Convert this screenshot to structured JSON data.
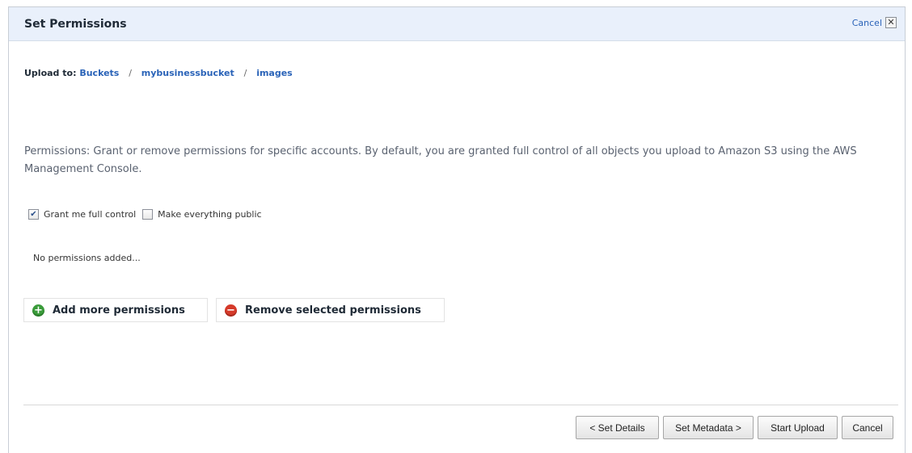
{
  "dialog": {
    "title": "Set Permissions",
    "cancel_link": "Cancel",
    "close_glyph": "✕"
  },
  "upload_to": {
    "label": "Upload to:",
    "path": [
      "Buckets",
      "mybusinessbucket",
      "images"
    ],
    "separator": "/"
  },
  "description": "Permissions: Grant or remove permissions for specific accounts. By default, you are granted full control of all objects you upload to Amazon S3 using the AWS Management Console.",
  "options": {
    "grant_full_control": {
      "label": "Grant me full control",
      "checked": true
    },
    "make_public": {
      "label": "Make everything public",
      "checked": false
    }
  },
  "empty_state": "No permissions added...",
  "actions": {
    "add": "Add more permissions",
    "remove": "Remove selected permissions"
  },
  "footer": {
    "set_details": "< Set Details",
    "set_metadata": "Set Metadata >",
    "start_upload": "Start Upload",
    "cancel": "Cancel"
  },
  "colors": {
    "titlebar_bg": "#e9f0fb",
    "link": "#2a63b8",
    "add_icon": "#3a9b3a",
    "remove_icon": "#d53a2a"
  }
}
